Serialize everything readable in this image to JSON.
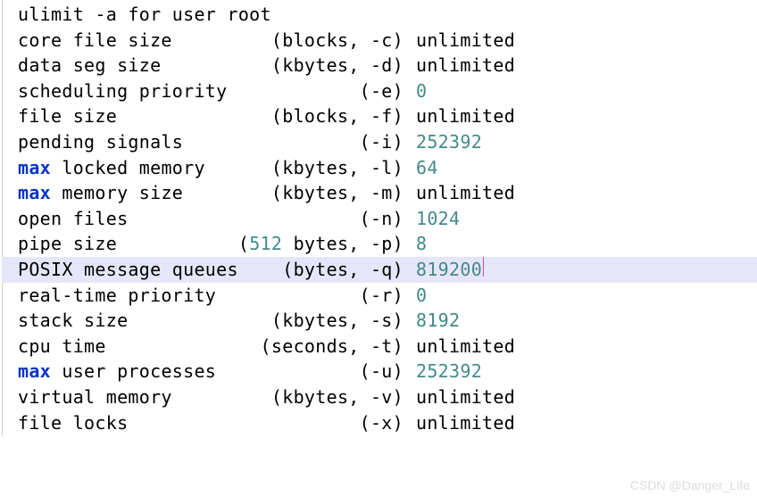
{
  "header": "ulimit -a for user root",
  "rows": [
    {
      "desc_pre": "",
      "desc_kw": "",
      "desc_post": "core file size",
      "spec_open": "(",
      "spec_text": "blocks, ",
      "spec_flag": "-c",
      "spec_close": ")",
      "value": "unlimited",
      "value_is_num": false
    },
    {
      "desc_pre": "",
      "desc_kw": "",
      "desc_post": "data seg size",
      "spec_open": "(",
      "spec_text": "kbytes, ",
      "spec_flag": "-d",
      "spec_close": ")",
      "value": "unlimited",
      "value_is_num": false
    },
    {
      "desc_pre": "",
      "desc_kw": "",
      "desc_post": "scheduling priority",
      "spec_open": "(",
      "spec_text": "",
      "spec_flag": "-e",
      "spec_close": ")",
      "value": "0",
      "value_is_num": true
    },
    {
      "desc_pre": "",
      "desc_kw": "",
      "desc_post": "file size",
      "spec_open": "(",
      "spec_text": "blocks, ",
      "spec_flag": "-f",
      "spec_close": ")",
      "value": "unlimited",
      "value_is_num": false
    },
    {
      "desc_pre": "",
      "desc_kw": "",
      "desc_post": "pending signals",
      "spec_open": "(",
      "spec_text": "",
      "spec_flag": "-i",
      "spec_close": ")",
      "value": "252392",
      "value_is_num": true
    },
    {
      "desc_pre": "",
      "desc_kw": "max",
      "desc_post": " locked memory",
      "spec_open": "(",
      "spec_text": "kbytes, ",
      "spec_flag": "-l",
      "spec_close": ")",
      "value": "64",
      "value_is_num": true
    },
    {
      "desc_pre": "",
      "desc_kw": "max",
      "desc_post": " memory size",
      "spec_open": "(",
      "spec_text": "kbytes, ",
      "spec_flag": "-m",
      "spec_close": ")",
      "value": "unlimited",
      "value_is_num": false
    },
    {
      "desc_pre": "",
      "desc_kw": "",
      "desc_post": "open files",
      "spec_open": "(",
      "spec_text": "",
      "spec_flag": "-n",
      "spec_close": ")",
      "value": "1024",
      "value_is_num": true
    },
    {
      "desc_pre": "",
      "desc_kw": "",
      "desc_post": "pipe size",
      "spec_open": "(",
      "spec_num": "512",
      "spec_text": " bytes, ",
      "spec_flag": "-p",
      "spec_close": ")",
      "value": "8",
      "value_is_num": true
    },
    {
      "desc_pre": "",
      "desc_kw": "",
      "desc_post": "POSIX message queues",
      "spec_open": "(",
      "spec_text": "bytes, ",
      "spec_flag": "-q",
      "spec_close": ")",
      "value": "819200",
      "value_is_num": true,
      "highlight": true,
      "cursor_after": true
    },
    {
      "desc_pre": "",
      "desc_kw": "",
      "desc_post": "real-time priority",
      "spec_open": "(",
      "spec_text": "",
      "spec_flag": "-r",
      "spec_close": ")",
      "value": "0",
      "value_is_num": true
    },
    {
      "desc_pre": "",
      "desc_kw": "",
      "desc_post": "stack size",
      "spec_open": "(",
      "spec_text": "kbytes, ",
      "spec_flag": "-s",
      "spec_close": ")",
      "value": "8192",
      "value_is_num": true
    },
    {
      "desc_pre": "",
      "desc_kw": "",
      "desc_post": "cpu time",
      "spec_open": "(",
      "spec_text": "seconds, ",
      "spec_flag": "-t",
      "spec_close": ")",
      "value": "unlimited",
      "value_is_num": false
    },
    {
      "desc_pre": "",
      "desc_kw": "max",
      "desc_post": " user processes",
      "spec_open": "(",
      "spec_text": "",
      "spec_flag": "-u",
      "spec_close": ")",
      "value": "252392",
      "value_is_num": true
    },
    {
      "desc_pre": "",
      "desc_kw": "",
      "desc_post": "virtual memory",
      "spec_open": "(",
      "spec_text": "kbytes, ",
      "spec_flag": "-v",
      "spec_close": ")",
      "value": "unlimited",
      "value_is_num": false
    },
    {
      "desc_pre": "",
      "desc_kw": "",
      "desc_post": "file locks",
      "spec_open": "(",
      "spec_text": "",
      "spec_flag": "-x",
      "spec_close": ")",
      "value": "unlimited",
      "value_is_num": false
    }
  ],
  "watermark": "CSDN @Danger_Life"
}
